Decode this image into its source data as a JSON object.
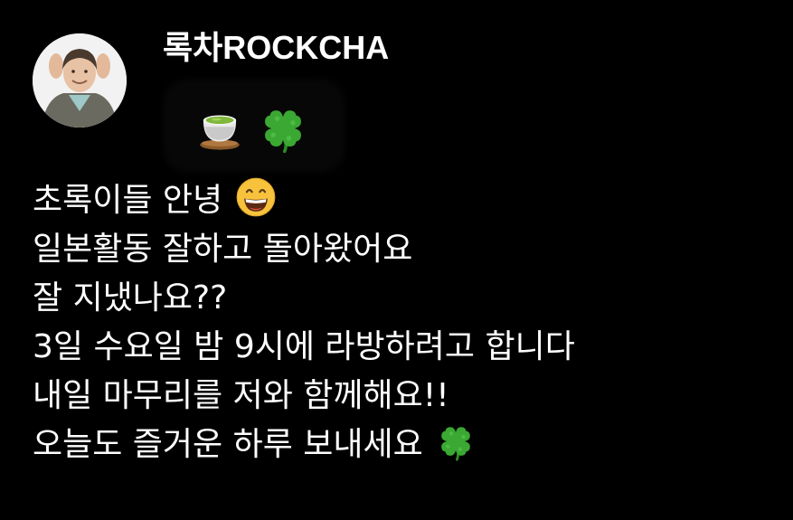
{
  "profile": {
    "username": "록차ROCKCHA"
  },
  "status": {
    "emojis": [
      "tea-icon",
      "four-leaf-clover-icon"
    ]
  },
  "message": {
    "lines": [
      "초록이들 안녕",
      "일본활동 잘하고 돌아왔어요",
      "잘 지냈나요??",
      "3일 수요일 밤 9시에 라방하려고 합니다",
      "내일 마무리를 저와 함께해요!!",
      "오늘도 즐거운 하루 보내세요"
    ],
    "line1_emoji": "grinning-face-icon",
    "line6_emoji": "four-leaf-clover-icon"
  },
  "colors": {
    "background": "#000000",
    "text": "#ffffff",
    "clover": "#3aa832",
    "emoji_face": "#f7c23c"
  }
}
